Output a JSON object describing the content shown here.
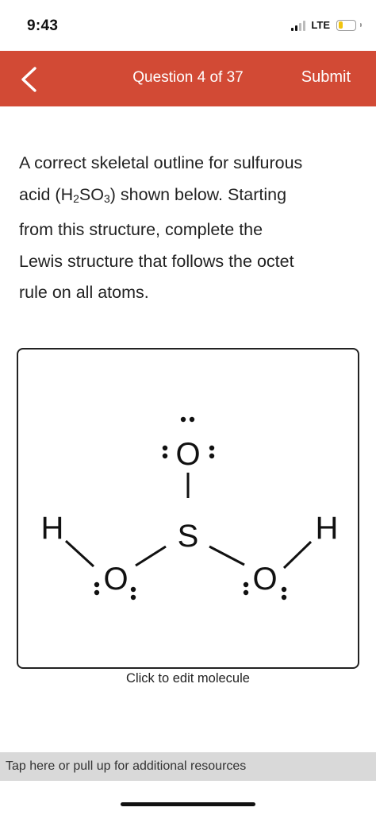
{
  "status_bar": {
    "time": "9:43",
    "network": "LTE",
    "signal_icon": "cellular-signal-icon",
    "battery_icon": "battery-icon",
    "battery_level": 0.25,
    "battery_color": "#f1c40f"
  },
  "header": {
    "back_icon": "chevron-left-icon",
    "title": "Question 4 of 37",
    "submit_label": "Submit",
    "background_color": "#d24a35"
  },
  "question": {
    "line1": "A correct skeletal outline for sulfurous",
    "line2_before": "acid (H",
    "line2_sub1": "2",
    "line2_mid": "SO",
    "line2_sub2": "3",
    "line2_after": ") shown below. Starting",
    "line3": "from this structure, complete the",
    "line4": "Lewis structure that follows the octet",
    "line5": "rule on all atoms."
  },
  "molecule": {
    "caption": "Click to edit molecule",
    "atoms": {
      "top_oxygen": "O",
      "sulfur": "S",
      "left_oxygen": "O",
      "right_oxygen": "O",
      "left_hydrogen": "H",
      "right_hydrogen": "H"
    }
  },
  "resources": {
    "label": "Tap here or pull up for additional resources"
  }
}
